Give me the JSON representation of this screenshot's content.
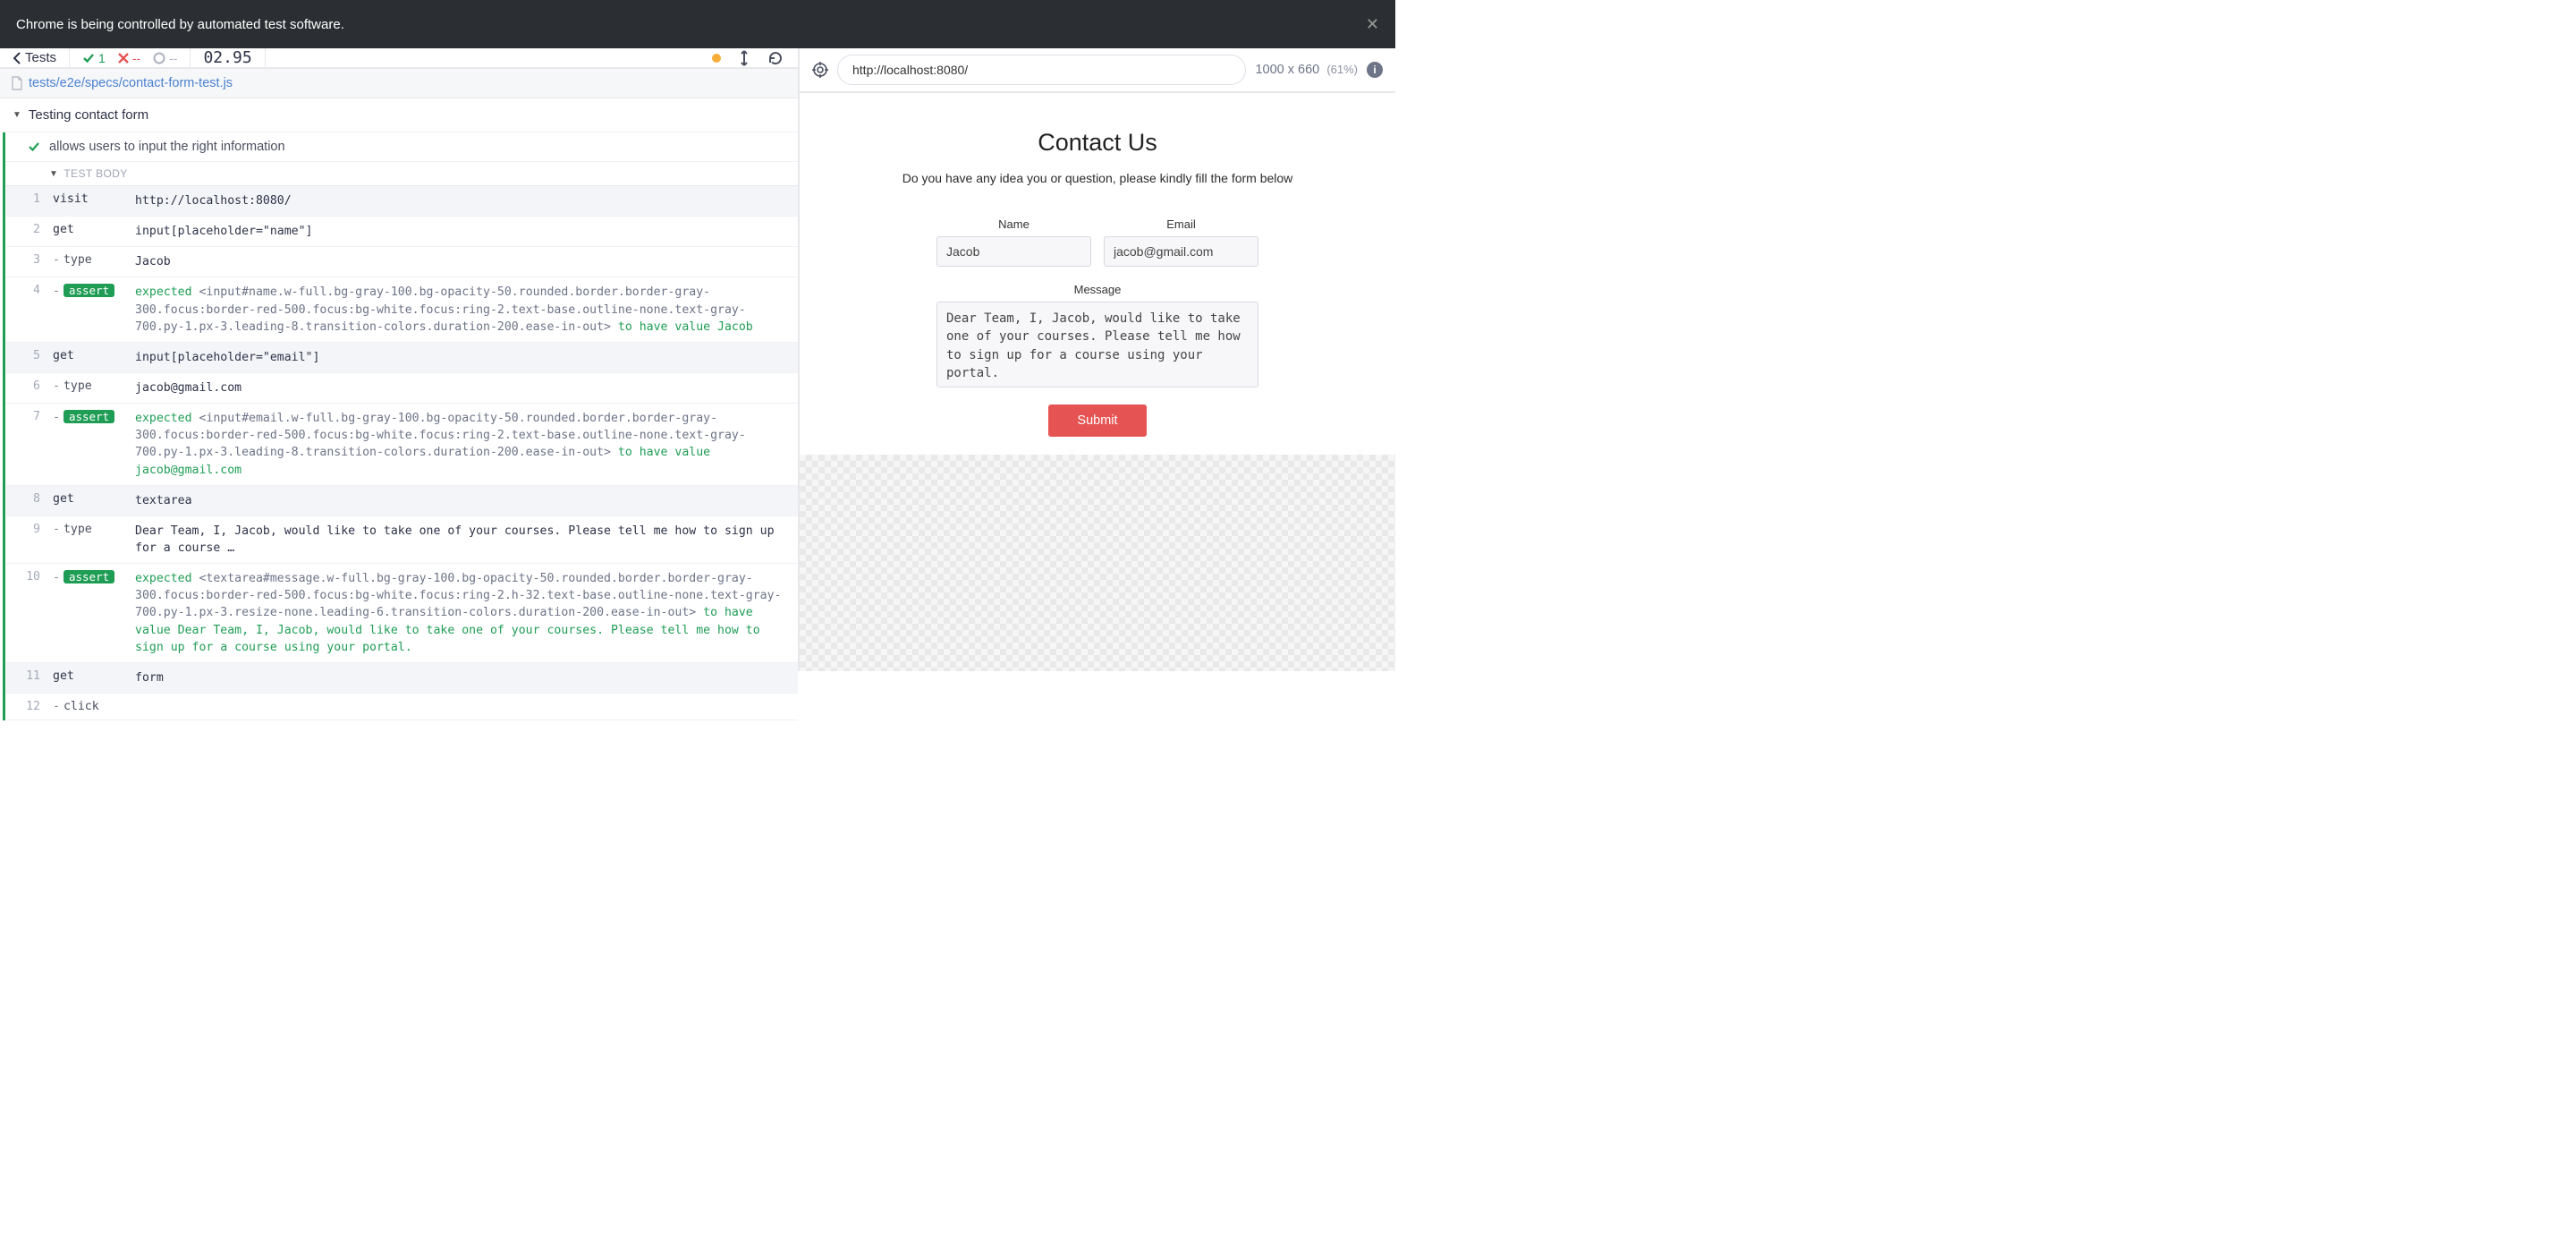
{
  "automation_bar": {
    "message": "Chrome is being controlled by automated test software."
  },
  "toolbar": {
    "back_label": "Tests",
    "pass_count": "1",
    "fail_count": "--",
    "pending_count": "--",
    "timer": "02.95"
  },
  "file_path": "tests/e2e/specs/contact-form-test.js",
  "suite_title": "Testing contact form",
  "test_title": "allows users to input the right information",
  "body_label": "TEST BODY",
  "commands": [
    {
      "n": "1",
      "shade": true,
      "name": "visit",
      "sub": false,
      "content": "http://localhost:8080/"
    },
    {
      "n": "2",
      "shade": false,
      "name": "get",
      "sub": false,
      "content": "input[placeholder=\"name\"]"
    },
    {
      "n": "3",
      "shade": false,
      "name": "type",
      "sub": true,
      "content": "Jacob"
    },
    {
      "n": "4",
      "shade": false,
      "name": "assert",
      "sub": true,
      "assert": true,
      "pre": "expected ",
      "el": "<input#name.w-full.bg-gray-100.bg-opacity-50.rounded.border.border-gray-300.focus:border-red-500.focus:bg-white.focus:ring-2.text-base.outline-none.text-gray-700.py-1.px-3.leading-8.transition-colors.duration-200.ease-in-out>",
      "mid": " to have value ",
      "post": "Jacob"
    },
    {
      "n": "5",
      "shade": true,
      "name": "get",
      "sub": false,
      "content": "input[placeholder=\"email\"]"
    },
    {
      "n": "6",
      "shade": false,
      "name": "type",
      "sub": true,
      "content": "jacob@gmail.com"
    },
    {
      "n": "7",
      "shade": false,
      "name": "assert",
      "sub": true,
      "assert": true,
      "pre": "expected ",
      "el": "<input#email.w-full.bg-gray-100.bg-opacity-50.rounded.border.border-gray-300.focus:border-red-500.focus:bg-white.focus:ring-2.text-base.outline-none.text-gray-700.py-1.px-3.leading-8.transition-colors.duration-200.ease-in-out>",
      "mid": " to have value ",
      "post": "jacob@gmail.com"
    },
    {
      "n": "8",
      "shade": true,
      "name": "get",
      "sub": false,
      "content": "textarea"
    },
    {
      "n": "9",
      "shade": false,
      "name": "type",
      "sub": true,
      "content": "Dear Team, I, Jacob, would like to take one of your courses. Please tell me how to sign up for a course …"
    },
    {
      "n": "10",
      "shade": false,
      "name": "assert",
      "sub": true,
      "assert": true,
      "pre": "expected ",
      "el": "<textarea#message.w-full.bg-gray-100.bg-opacity-50.rounded.border.border-gray-300.focus:border-red-500.focus:bg-white.focus:ring-2.h-32.text-base.outline-none.text-gray-700.py-1.px-3.resize-none.leading-6.transition-colors.duration-200.ease-in-out>",
      "mid": " to have value ",
      "post": "Dear Team, I, Jacob, would like to take one of your courses. Please tell me how to sign up for a course using your portal."
    },
    {
      "n": "11",
      "shade": true,
      "name": "get",
      "sub": false,
      "content": "form"
    },
    {
      "n": "12",
      "shade": false,
      "name": "click",
      "sub": true,
      "content": ""
    }
  ],
  "url_bar": {
    "url": "http://localhost:8080/",
    "dimensions": "1000 x 660",
    "scale": "(61%)"
  },
  "preview": {
    "heading": "Contact Us",
    "subtext": "Do you have any idea you or question, please kindly fill the form below",
    "name_label": "Name",
    "email_label": "Email",
    "message_label": "Message",
    "name_value": "Jacob",
    "email_value": "jacob@gmail.com",
    "message_value": "Dear Team, I, Jacob, would like to take one of your courses. Please tell me how to sign up for a course using your portal.",
    "submit_label": "Submit"
  }
}
